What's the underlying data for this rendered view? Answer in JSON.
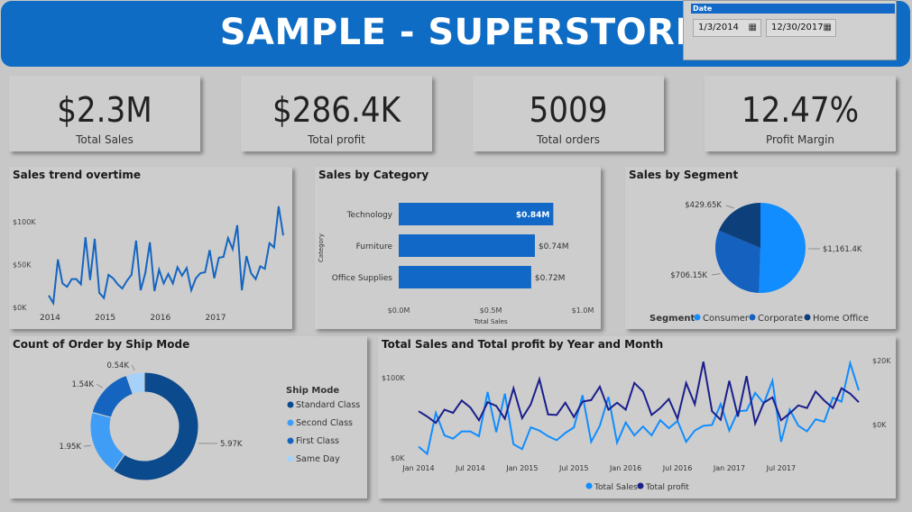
{
  "header": {
    "title": "SAMPLE - SUPERSTORE"
  },
  "date_filter": {
    "label": "Date",
    "start": "1/3/2014",
    "end": "12/30/2017",
    "calendar_icon": "calendar-icon"
  },
  "kpis": [
    {
      "value": "$2.3M",
      "label": "Total Sales"
    },
    {
      "value": "$286.4K",
      "label": "Total profit"
    },
    {
      "value": "5009",
      "label": "Total orders"
    },
    {
      "value": "12.47%",
      "label": "Profit Margin"
    }
  ],
  "colors": {
    "primary": "#0f6cc4",
    "dark": "#0b3f7a",
    "light": "#2b8ff5",
    "lightest": "#8ec5f7",
    "navy": "#1a1f8c"
  },
  "chart_data": [
    {
      "id": "sales_trend",
      "type": "line",
      "title": "Sales trend overtime",
      "y_ticks": [
        "$100K",
        "$50K",
        "$0K"
      ],
      "y_tick_values": [
        100,
        50,
        0
      ],
      "ylim": [
        0,
        120
      ],
      "x_ticks": [
        "2014",
        "2015",
        "2016",
        "2017"
      ],
      "x_tick_months": [
        0,
        12,
        24,
        36
      ],
      "series": [
        {
          "values": [
            14,
            5,
            56,
            28,
            24,
            33,
            33,
            27,
            82,
            32,
            80,
            17,
            11,
            38,
            34,
            27,
            22,
            31,
            38,
            78,
            20,
            40,
            76,
            19,
            44,
            28,
            39,
            28,
            47,
            37,
            46,
            20,
            34,
            40,
            41,
            67,
            34,
            58,
            59,
            81,
            68,
            96,
            20,
            60,
            40,
            33,
            48,
            45,
            75,
            70,
            118,
            84
          ]
        }
      ]
    },
    {
      "id": "sales_by_category",
      "type": "bar",
      "title": "Sales by Category",
      "categories": [
        "Technology",
        "Furniture",
        "Office Supplies"
      ],
      "values": [
        0.84,
        0.74,
        0.72
      ],
      "labels": [
        "$0.84M",
        "$0.74M",
        "$0.72M"
      ],
      "x_ticks": [
        "$0.0M",
        "$0.5M",
        "$1.0M"
      ],
      "xlim": [
        0,
        1.0
      ],
      "xlabel": "Total Sales",
      "ylabel": "Category"
    },
    {
      "id": "sales_by_segment",
      "type": "pie",
      "title": "Sales by Segment",
      "legend_title": "Segment",
      "categories": [
        "Consumer",
        "Corporate",
        "Home Office"
      ],
      "values": [
        1161.4,
        706.15,
        429.65
      ],
      "labels": [
        "$1,161.4K",
        "$706.15K",
        "$429.65K"
      ],
      "colors": [
        "#118dff",
        "#1461bf",
        "#0d3f7b"
      ]
    },
    {
      "id": "orders_by_ship_mode",
      "type": "pie",
      "title": "Count of Order by Ship Mode",
      "legend_title": "Ship Mode",
      "categories": [
        "Standard Class",
        "Second Class",
        "First Class",
        "Same Day"
      ],
      "values": [
        5.97,
        1.95,
        1.54,
        0.54
      ],
      "labels": [
        "5.97K",
        "1.95K",
        "1.54K",
        "0.54K"
      ],
      "colors": [
        "#0b4a8c",
        "#3f9df5",
        "#1565c0",
        "#a6d1f8"
      ]
    },
    {
      "id": "sales_profit_by_month",
      "type": "line",
      "title": "Total Sales and Total profit by Year and Month",
      "y_ticks_left": [
        "$100K",
        "$0K"
      ],
      "y_ticks_right": [
        "$20K",
        "$0K"
      ],
      "x_ticks": [
        "Jan 2014",
        "Jul 2014",
        "Jan 2015",
        "Jul 2015",
        "Jan 2016",
        "Jul 2016",
        "Jan 2017",
        "Jul 2017"
      ],
      "x_tick_months": [
        0,
        6,
        12,
        18,
        24,
        30,
        36,
        42
      ],
      "series": [
        {
          "name": "Total Sales",
          "values": [
            14,
            5,
            56,
            28,
            24,
            33,
            33,
            27,
            82,
            32,
            80,
            17,
            11,
            38,
            34,
            27,
            22,
            31,
            38,
            78,
            20,
            40,
            76,
            19,
            44,
            28,
            39,
            28,
            47,
            37,
            46,
            20,
            34,
            40,
            41,
            67,
            34,
            58,
            59,
            81,
            68,
            96,
            20,
            60,
            40,
            33,
            48,
            45,
            75,
            70,
            118,
            84
          ]
        },
        {
          "name": "Total profit",
          "values": [
            2.5,
            1.5,
            0.3,
            2.8,
            2.2,
            4.5,
            3.2,
            0.8,
            4.2,
            3.5,
            1.1,
            6.8,
            1.2,
            3.8,
            8.5,
            1.9,
            1.8,
            4.1,
            1.4,
            4.3,
            4.6,
            7.1,
            2.8,
            4.1,
            2.8,
            7.8,
            6.2,
            1.8,
            3.1,
            4.8,
            1.1,
            7.8,
            3.8,
            11.8,
            2.5,
            0.9,
            8.2,
            1.5,
            9.1,
            0.2,
            4.1,
            5.1,
            0.8,
            2.1,
            3.6,
            3.1,
            6.2,
            4.5,
            3.1,
            6.8,
            5.8,
            4.2
          ]
        }
      ]
    }
  ]
}
